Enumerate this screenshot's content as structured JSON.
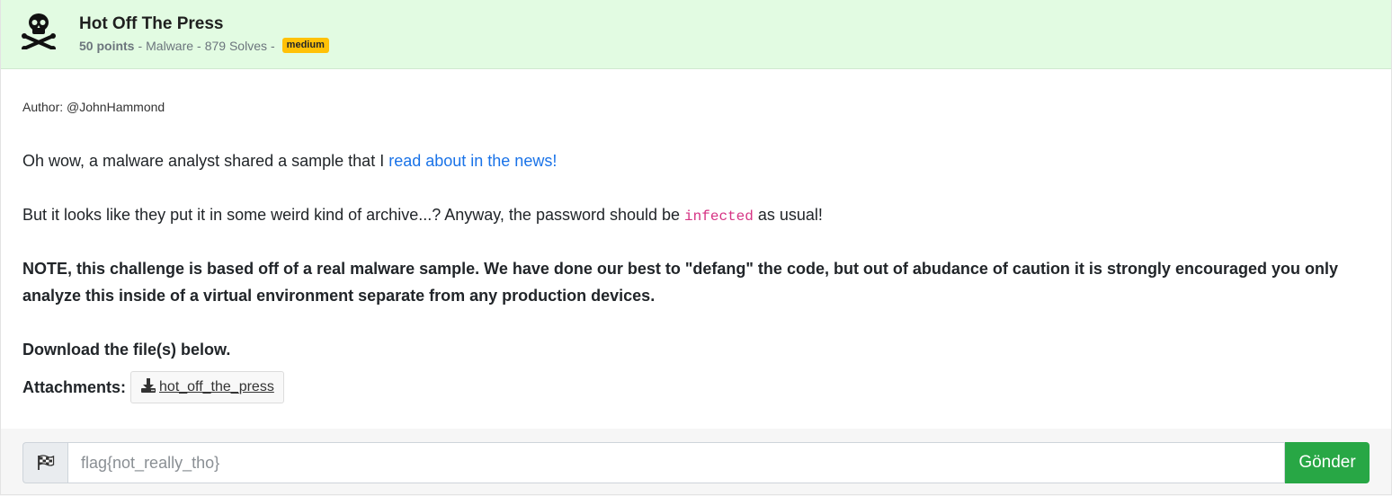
{
  "challenge": {
    "title": "Hot Off The Press",
    "points": "50 points",
    "category": "Malware",
    "solves": "879 Solves",
    "difficulty": "medium",
    "icon": "skull-crossbones-icon",
    "header_color": "#e2fbe2"
  },
  "description": {
    "author": "Author: @JohnHammond",
    "p1_prefix": "Oh wow, a malware analyst shared a sample that I ",
    "p1_link": "read about in the news!",
    "p2_prefix": "But it looks like they put it in some weird kind of archive...? Anyway, the password should be ",
    "p2_code": "infected",
    "p2_suffix": " as usual!",
    "note": "NOTE, this challenge is based off of a real malware sample. We have done our best to \"defang\" the code, but out of abudance of caution it is strongly encouraged you only analyze this inside of a virtual environment separate from any production devices.",
    "download": "Download the file(s) below."
  },
  "attachments": {
    "label": "Attachments:",
    "files": [
      "hot_off_the_press"
    ]
  },
  "submission": {
    "placeholder": "flag{not_really_tho}",
    "value": "",
    "submit_label": "Gönder",
    "submit_color": "#28a745"
  }
}
